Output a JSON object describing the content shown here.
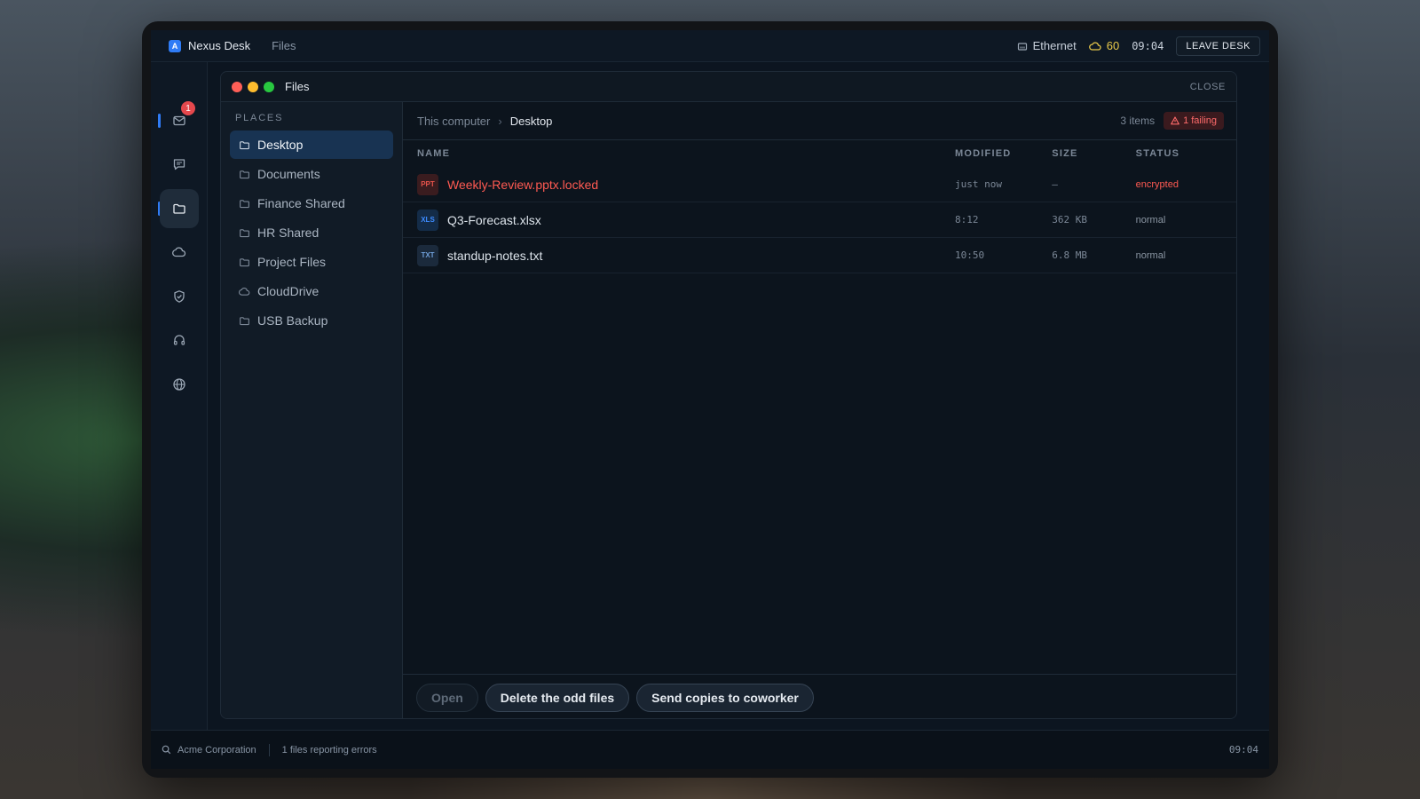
{
  "topbar": {
    "app_logo": "A",
    "app_name": "Nexus Desk",
    "section": "Files",
    "network": "Ethernet",
    "weather_value": "60",
    "time": "09:04",
    "leave_label": "LEAVE DESK"
  },
  "rail": {
    "items": [
      {
        "icon": "mail-icon",
        "badge": "1"
      },
      {
        "icon": "chat-icon"
      },
      {
        "icon": "folder-icon",
        "active": true
      },
      {
        "icon": "cloud-icon"
      },
      {
        "icon": "shield-icon"
      },
      {
        "icon": "headset-icon"
      },
      {
        "icon": "globe-icon"
      }
    ]
  },
  "window": {
    "title": "Files",
    "close_label": "CLOSE"
  },
  "places": {
    "heading": "PLACES",
    "items": [
      {
        "label": "Desktop",
        "icon": "folder-icon"
      },
      {
        "label": "Documents",
        "icon": "folder-icon"
      },
      {
        "label": "Finance Shared",
        "icon": "folder-icon"
      },
      {
        "label": "HR Shared",
        "icon": "folder-icon"
      },
      {
        "label": "Project Files",
        "icon": "folder-icon"
      },
      {
        "label": "CloudDrive",
        "icon": "cloud-icon"
      },
      {
        "label": "USB Backup",
        "icon": "folder-icon"
      }
    ]
  },
  "path": {
    "root": "This computer",
    "separator": "›",
    "current": "Desktop",
    "count": "3 items",
    "failing": "1 failing"
  },
  "table": {
    "headers": [
      "NAME",
      "MODIFIED",
      "SIZE",
      "STATUS"
    ],
    "rows": [
      {
        "type": "PPT",
        "name": "Weekly-Review.pptx.locked",
        "modified": "just now",
        "size": "—",
        "status": "encrypted"
      },
      {
        "type": "XLS",
        "name": "Q3-Forecast.xlsx",
        "modified": "8:12",
        "size": "362 KB",
        "status": "normal"
      },
      {
        "type": "TXT",
        "name": "standup-notes.txt",
        "modified": "10:50",
        "size": "6.8 MB",
        "status": "normal"
      }
    ]
  },
  "actions": {
    "open": "Open",
    "delete": "Delete the odd files",
    "send": "Send copies to coworker"
  },
  "statusbar": {
    "org": "Acme Corporation",
    "message": "1 files reporting errors",
    "time": "09:04"
  },
  "colors": {
    "accent": "#2f7cf6",
    "error": "#ff5a52",
    "warning": "#e9c94a"
  }
}
